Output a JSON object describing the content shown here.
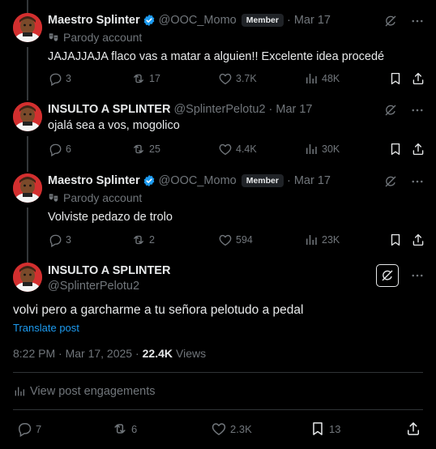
{
  "tweets": [
    {
      "name": "Maestro Splinter",
      "verified": true,
      "handle": "@OOC_Momo",
      "badge": "Member",
      "time": "Mar 17",
      "parody_label": "Parody account",
      "text": "JAJAJJAJA flaco vas a matar a alguien!! Excelente idea procedé",
      "stats": {
        "replies": "3",
        "reposts": "17",
        "likes": "3.7K",
        "views": "48K"
      }
    },
    {
      "name": "INSULTO A SPLINTER",
      "handle": "@SplinterPelotu2",
      "time": "Mar 17",
      "text": "ojalá sea a vos, mogolico",
      "stats": {
        "replies": "6",
        "reposts": "25",
        "likes": "4.4K",
        "views": "30K"
      }
    },
    {
      "name": "Maestro Splinter",
      "verified": true,
      "handle": "@OOC_Momo",
      "badge": "Member",
      "time": "Mar 17",
      "parody_label": "Parody account",
      "text": "Volviste pedazo de trolo",
      "stats": {
        "replies": "3",
        "reposts": "2",
        "likes": "594",
        "views": "23K"
      }
    }
  ],
  "main_post": {
    "name": "INSULTO A SPLINTER",
    "handle": "@SplinterPelotu2",
    "text": "volvi pero a garcharme a tu señora pelotudo a pedal",
    "translate_label": "Translate post",
    "timestamp": "8:22 PM · Mar 17, 2025 ·",
    "views_count": "22.4K",
    "views_label": "Views",
    "engagements_label": "View post engagements",
    "stats": {
      "replies": "7",
      "reposts": "6",
      "likes": "2.3K",
      "bookmarks": "13"
    }
  },
  "separator": "·",
  "icons": [
    "grok-icon",
    "more-icon",
    "reply-icon",
    "repost-icon",
    "like-icon",
    "views-icon",
    "bookmark-icon",
    "share-icon",
    "verified-icon",
    "parody-icon"
  ],
  "colors": {
    "background": "#000000",
    "text": "#e7e9ea",
    "muted": "#71767b",
    "link": "#1d9bf0",
    "verified": "#1d9bf0",
    "divider": "#2f3336"
  }
}
